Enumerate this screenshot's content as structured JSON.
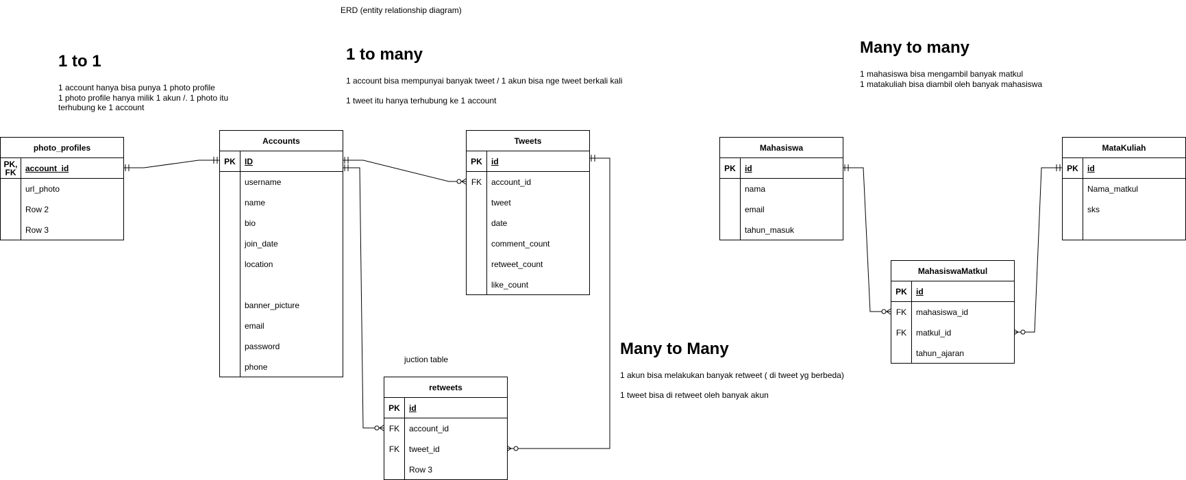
{
  "title": "ERD (entity relationship diagram)",
  "sections": {
    "one_to_one": {
      "heading": "1 to 1",
      "description": "1 account hanya bisa punya 1 photo profile\n1 photo profile hanya milik 1 akun /. 1 photo itu\nterhubung ke 1 account"
    },
    "one_to_many": {
      "heading": "1 to many",
      "line1": "1 account bisa mempunyai banyak tweet / 1 akun bisa nge tweet berkali kali",
      "line2": "1 tweet itu hanya terhubung ke 1 account"
    },
    "many_to_many_a": {
      "heading": "Many to Many",
      "line1": "1 akun bisa melakukan banyak retweet ( di tweet yg berbeda)",
      "line2": "1 tweet bisa di retweet oleh banyak akun"
    },
    "many_to_many_b": {
      "heading": "Many to many",
      "description": "1 mahasiswa bisa mengambil banyak matkul\n1 matakuliah bisa diambil oleh banyak mahasiswa"
    }
  },
  "junction_note": "juction table",
  "entities": {
    "photo_profiles": {
      "name": "photo_profiles",
      "pk": {
        "key": "PK,\nFK",
        "field": "account_id"
      },
      "rows": [
        {
          "key": "",
          "field": "url_photo"
        },
        {
          "key": "",
          "field": "Row 2"
        },
        {
          "key": "",
          "field": "Row 3"
        }
      ]
    },
    "accounts": {
      "name": "Accounts",
      "pk": {
        "key": "PK",
        "field": "ID"
      },
      "rows": [
        {
          "key": "",
          "field": "username"
        },
        {
          "key": "",
          "field": "name"
        },
        {
          "key": "",
          "field": "bio"
        },
        {
          "key": "",
          "field": "join_date"
        },
        {
          "key": "",
          "field": "location"
        },
        {
          "key": "",
          "field": ""
        },
        {
          "key": "",
          "field": "banner_picture"
        },
        {
          "key": "",
          "field": "email"
        },
        {
          "key": "",
          "field": "password"
        },
        {
          "key": "",
          "field": "phone"
        }
      ]
    },
    "tweets": {
      "name": "Tweets",
      "pk": {
        "key": "PK",
        "field": "id"
      },
      "rows": [
        {
          "key": "FK",
          "field": "account_id"
        },
        {
          "key": "",
          "field": "tweet"
        },
        {
          "key": "",
          "field": "date"
        },
        {
          "key": "",
          "field": "comment_count"
        },
        {
          "key": "",
          "field": "retweet_count"
        },
        {
          "key": "",
          "field": "like_count"
        }
      ]
    },
    "retweets": {
      "name": "retweets",
      "pk": {
        "key": "PK",
        "field": "id"
      },
      "rows": [
        {
          "key": "FK",
          "field": "account_id"
        },
        {
          "key": "FK",
          "field": "tweet_id"
        },
        {
          "key": "",
          "field": "Row 3"
        }
      ]
    },
    "mahasiswa": {
      "name": "Mahasiswa",
      "pk": {
        "key": "PK",
        "field": "id"
      },
      "rows": [
        {
          "key": "",
          "field": "nama"
        },
        {
          "key": "",
          "field": "email"
        },
        {
          "key": "",
          "field": "tahun_masuk"
        }
      ]
    },
    "matakuliah": {
      "name": "MataKuliah",
      "pk": {
        "key": "PK",
        "field": "id"
      },
      "rows": [
        {
          "key": "",
          "field": "Nama_matkul"
        },
        {
          "key": "",
          "field": "sks"
        }
      ]
    },
    "mahasiswamatkul": {
      "name": "MahasiswaMatkul",
      "pk": {
        "key": "PK",
        "field": "id"
      },
      "rows": [
        {
          "key": "FK",
          "field": "mahasiswa_id"
        },
        {
          "key": "FK",
          "field": "matkul_id"
        },
        {
          "key": "",
          "field": "tahun_ajaran"
        }
      ]
    }
  },
  "relationships": [
    {
      "from": "photo_profiles.account_id",
      "to": "Accounts.ID",
      "type": "one-to-one"
    },
    {
      "from": "Accounts.ID",
      "to": "Tweets.account_id",
      "type": "one-to-many"
    },
    {
      "from": "Accounts.ID",
      "to": "retweets.account_id",
      "type": "one-to-many"
    },
    {
      "from": "Tweets.id",
      "to": "retweets.tweet_id",
      "type": "one-to-many"
    },
    {
      "from": "Mahasiswa.id",
      "to": "MahasiswaMatkul.mahasiswa_id",
      "type": "one-to-many"
    },
    {
      "from": "MataKuliah.id",
      "to": "MahasiswaMatkul.matkul_id",
      "type": "one-to-many"
    }
  ]
}
